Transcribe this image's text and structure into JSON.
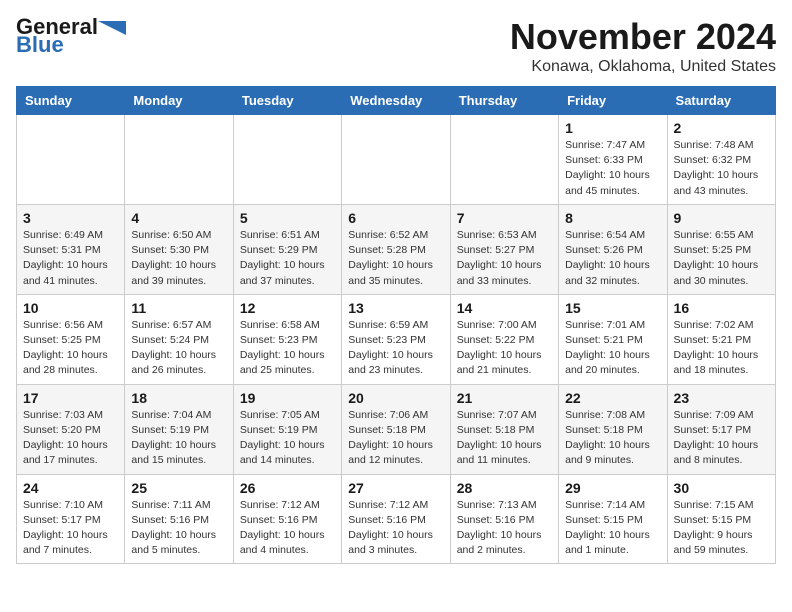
{
  "logo": {
    "text_general": "General",
    "text_blue": "Blue"
  },
  "header": {
    "month": "November 2024",
    "location": "Konawa, Oklahoma, United States"
  },
  "weekdays": [
    "Sunday",
    "Monday",
    "Tuesday",
    "Wednesday",
    "Thursday",
    "Friday",
    "Saturday"
  ],
  "weeks": [
    [
      {
        "day": "",
        "info": ""
      },
      {
        "day": "",
        "info": ""
      },
      {
        "day": "",
        "info": ""
      },
      {
        "day": "",
        "info": ""
      },
      {
        "day": "",
        "info": ""
      },
      {
        "day": "1",
        "info": "Sunrise: 7:47 AM\nSunset: 6:33 PM\nDaylight: 10 hours\nand 45 minutes."
      },
      {
        "day": "2",
        "info": "Sunrise: 7:48 AM\nSunset: 6:32 PM\nDaylight: 10 hours\nand 43 minutes."
      }
    ],
    [
      {
        "day": "3",
        "info": "Sunrise: 6:49 AM\nSunset: 5:31 PM\nDaylight: 10 hours\nand 41 minutes."
      },
      {
        "day": "4",
        "info": "Sunrise: 6:50 AM\nSunset: 5:30 PM\nDaylight: 10 hours\nand 39 minutes."
      },
      {
        "day": "5",
        "info": "Sunrise: 6:51 AM\nSunset: 5:29 PM\nDaylight: 10 hours\nand 37 minutes."
      },
      {
        "day": "6",
        "info": "Sunrise: 6:52 AM\nSunset: 5:28 PM\nDaylight: 10 hours\nand 35 minutes."
      },
      {
        "day": "7",
        "info": "Sunrise: 6:53 AM\nSunset: 5:27 PM\nDaylight: 10 hours\nand 33 minutes."
      },
      {
        "day": "8",
        "info": "Sunrise: 6:54 AM\nSunset: 5:26 PM\nDaylight: 10 hours\nand 32 minutes."
      },
      {
        "day": "9",
        "info": "Sunrise: 6:55 AM\nSunset: 5:25 PM\nDaylight: 10 hours\nand 30 minutes."
      }
    ],
    [
      {
        "day": "10",
        "info": "Sunrise: 6:56 AM\nSunset: 5:25 PM\nDaylight: 10 hours\nand 28 minutes."
      },
      {
        "day": "11",
        "info": "Sunrise: 6:57 AM\nSunset: 5:24 PM\nDaylight: 10 hours\nand 26 minutes."
      },
      {
        "day": "12",
        "info": "Sunrise: 6:58 AM\nSunset: 5:23 PM\nDaylight: 10 hours\nand 25 minutes."
      },
      {
        "day": "13",
        "info": "Sunrise: 6:59 AM\nSunset: 5:23 PM\nDaylight: 10 hours\nand 23 minutes."
      },
      {
        "day": "14",
        "info": "Sunrise: 7:00 AM\nSunset: 5:22 PM\nDaylight: 10 hours\nand 21 minutes."
      },
      {
        "day": "15",
        "info": "Sunrise: 7:01 AM\nSunset: 5:21 PM\nDaylight: 10 hours\nand 20 minutes."
      },
      {
        "day": "16",
        "info": "Sunrise: 7:02 AM\nSunset: 5:21 PM\nDaylight: 10 hours\nand 18 minutes."
      }
    ],
    [
      {
        "day": "17",
        "info": "Sunrise: 7:03 AM\nSunset: 5:20 PM\nDaylight: 10 hours\nand 17 minutes."
      },
      {
        "day": "18",
        "info": "Sunrise: 7:04 AM\nSunset: 5:19 PM\nDaylight: 10 hours\nand 15 minutes."
      },
      {
        "day": "19",
        "info": "Sunrise: 7:05 AM\nSunset: 5:19 PM\nDaylight: 10 hours\nand 14 minutes."
      },
      {
        "day": "20",
        "info": "Sunrise: 7:06 AM\nSunset: 5:18 PM\nDaylight: 10 hours\nand 12 minutes."
      },
      {
        "day": "21",
        "info": "Sunrise: 7:07 AM\nSunset: 5:18 PM\nDaylight: 10 hours\nand 11 minutes."
      },
      {
        "day": "22",
        "info": "Sunrise: 7:08 AM\nSunset: 5:18 PM\nDaylight: 10 hours\nand 9 minutes."
      },
      {
        "day": "23",
        "info": "Sunrise: 7:09 AM\nSunset: 5:17 PM\nDaylight: 10 hours\nand 8 minutes."
      }
    ],
    [
      {
        "day": "24",
        "info": "Sunrise: 7:10 AM\nSunset: 5:17 PM\nDaylight: 10 hours\nand 7 minutes."
      },
      {
        "day": "25",
        "info": "Sunrise: 7:11 AM\nSunset: 5:16 PM\nDaylight: 10 hours\nand 5 minutes."
      },
      {
        "day": "26",
        "info": "Sunrise: 7:12 AM\nSunset: 5:16 PM\nDaylight: 10 hours\nand 4 minutes."
      },
      {
        "day": "27",
        "info": "Sunrise: 7:12 AM\nSunset: 5:16 PM\nDaylight: 10 hours\nand 3 minutes."
      },
      {
        "day": "28",
        "info": "Sunrise: 7:13 AM\nSunset: 5:16 PM\nDaylight: 10 hours\nand 2 minutes."
      },
      {
        "day": "29",
        "info": "Sunrise: 7:14 AM\nSunset: 5:15 PM\nDaylight: 10 hours\nand 1 minute."
      },
      {
        "day": "30",
        "info": "Sunrise: 7:15 AM\nSunset: 5:15 PM\nDaylight: 9 hours\nand 59 minutes."
      }
    ]
  ]
}
